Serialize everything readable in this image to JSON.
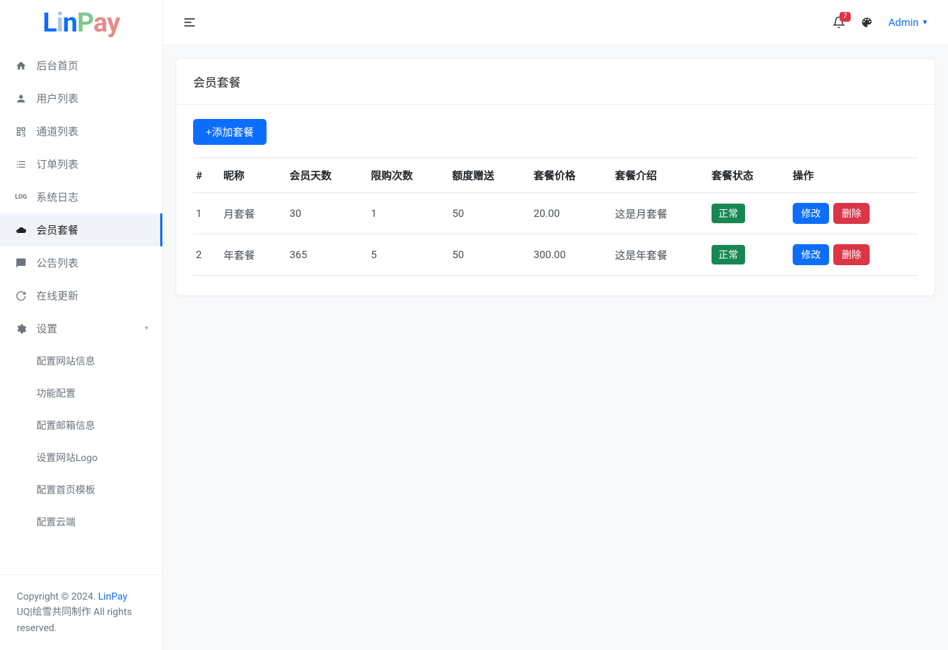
{
  "brand": "LinPay",
  "header": {
    "notif_count": "7",
    "user": "Admin"
  },
  "sidebar": {
    "items": [
      {
        "label": "后台首页",
        "icon": "home"
      },
      {
        "label": "用户列表",
        "icon": "user"
      },
      {
        "label": "通道列表",
        "icon": "qr"
      },
      {
        "label": "订单列表",
        "icon": "list"
      },
      {
        "label": "系统日志",
        "icon": "log"
      },
      {
        "label": "会员套餐",
        "icon": "cloud"
      },
      {
        "label": "公告列表",
        "icon": "chat"
      },
      {
        "label": "在线更新",
        "icon": "refresh"
      },
      {
        "label": "设置",
        "icon": "gear"
      }
    ],
    "settings_sub": [
      {
        "label": "配置网站信息"
      },
      {
        "label": "功能配置"
      },
      {
        "label": "配置邮箱信息"
      },
      {
        "label": "设置网站Logo"
      },
      {
        "label": "配置首页模板"
      },
      {
        "label": "配置云端"
      }
    ]
  },
  "footer": {
    "line1_prefix": "Copyright © 2024. ",
    "line1_link": "LinPay",
    "line2": "UQ|绘雪共同制作 All rights reserved."
  },
  "page": {
    "title": "会员套餐",
    "add_button": "+添加套餐",
    "columns": [
      "#",
      "昵称",
      "会员天数",
      "限购次数",
      "额度赠送",
      "套餐价格",
      "套餐介绍",
      "套餐状态",
      "操作"
    ],
    "status_normal": "正常",
    "edit_label": "修改",
    "delete_label": "删除",
    "rows": [
      {
        "id": "1",
        "name": "月套餐",
        "days": "30",
        "limit": "1",
        "gift": "50",
        "price": "20.00",
        "intro": "这是月套餐",
        "status": "正常"
      },
      {
        "id": "2",
        "name": "年套餐",
        "days": "365",
        "limit": "5",
        "gift": "50",
        "price": "300.00",
        "intro": "这是年套餐",
        "status": "正常"
      }
    ]
  }
}
